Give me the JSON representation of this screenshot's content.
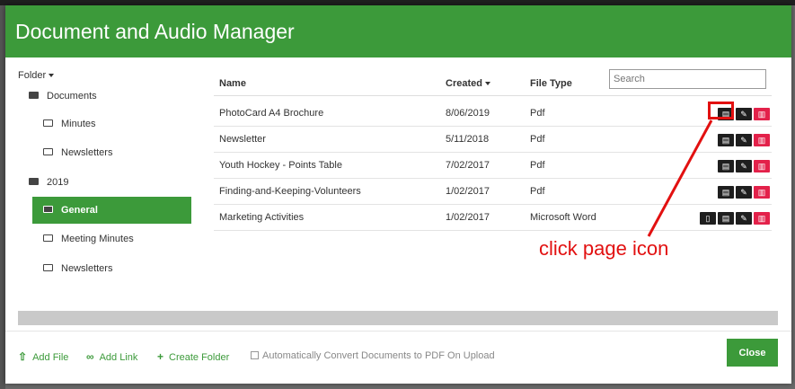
{
  "dialog": {
    "title": "Document and Audio Manager"
  },
  "folder_pane": {
    "header": "Folder",
    "items": [
      {
        "label": "Documents",
        "level": 0,
        "open": true
      },
      {
        "label": "Minutes",
        "level": 1
      },
      {
        "label": "Newsletters",
        "level": 1
      },
      {
        "label": "2019",
        "level": 0,
        "open": true
      },
      {
        "label": "General",
        "level": 1,
        "active": true
      },
      {
        "label": "Meeting Minutes",
        "level": 1
      },
      {
        "label": "Newsletters",
        "level": 1
      }
    ]
  },
  "table": {
    "columns": {
      "name": "Name",
      "created": "Created",
      "filetype": "File Type"
    },
    "search_placeholder": "Search",
    "rows": [
      {
        "name": "PhotoCard A4 Brochure",
        "created": "8/06/2019",
        "type": "Pdf"
      },
      {
        "name": "Newsletter",
        "created": "5/11/2018",
        "type": "Pdf"
      },
      {
        "name": "Youth Hockey - Points Table",
        "created": "7/02/2017",
        "type": "Pdf"
      },
      {
        "name": "Finding-and-Keeping-Volunteers",
        "created": "1/02/2017",
        "type": "Pdf"
      },
      {
        "name": "Marketing Activities",
        "created": "1/02/2017",
        "type": "Microsoft Word"
      }
    ]
  },
  "footer": {
    "add_file": "Add File",
    "add_link": "Add Link",
    "create_folder": "Create Folder",
    "auto_convert": "Automatically Convert Documents to PDF On Upload",
    "close": "Close"
  },
  "annotation": {
    "text": "click page icon",
    "color": "#e21010"
  },
  "colors": {
    "accent": "#3c9a3a",
    "delete": "#e3214a"
  }
}
